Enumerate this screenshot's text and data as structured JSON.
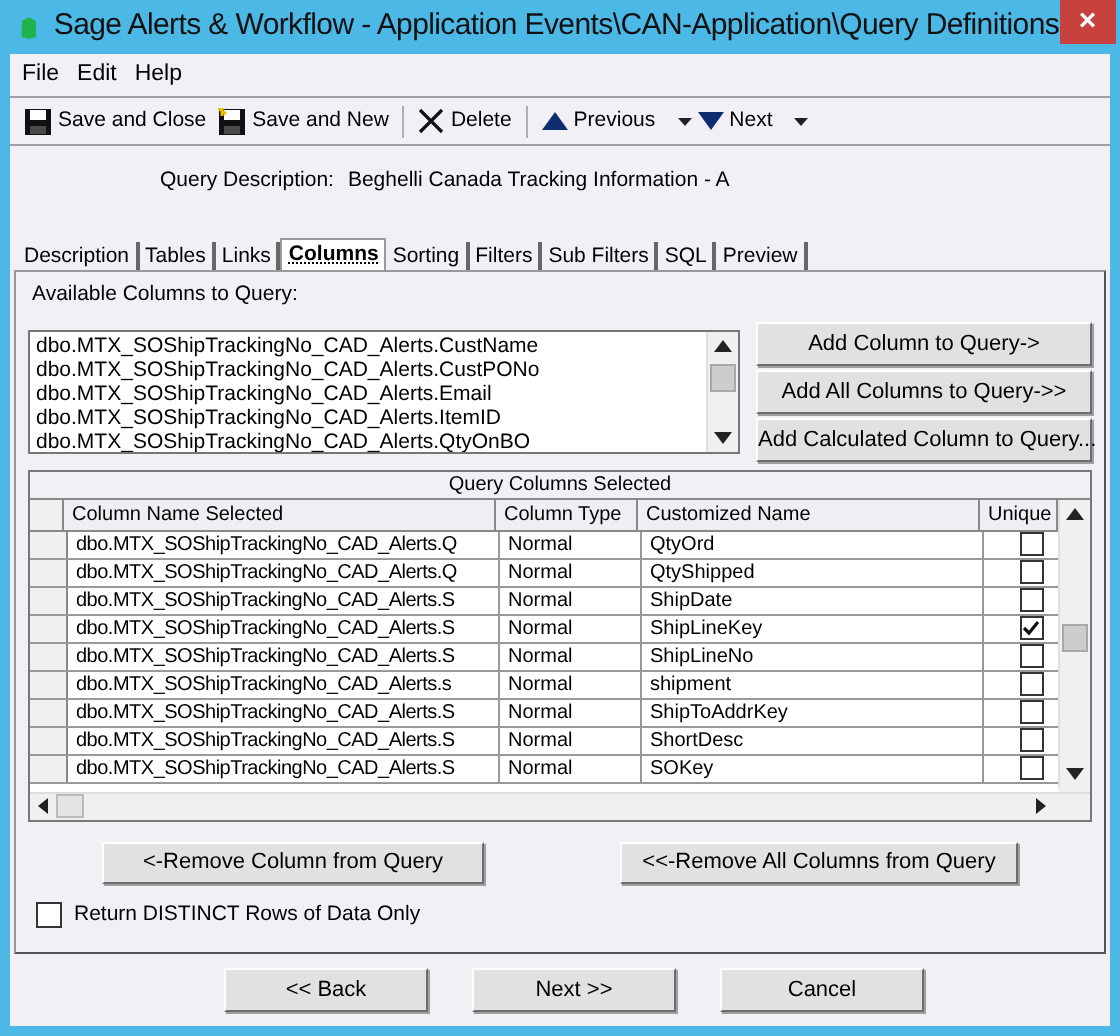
{
  "window": {
    "title": "Sage Alerts & Workflow - Application Events\\CAN-Application\\Query Definitions",
    "close": "×"
  },
  "menu": [
    "File",
    "Edit",
    "Help"
  ],
  "toolbar": [
    {
      "kind": "save",
      "label": "Save and Close"
    },
    {
      "kind": "savenew",
      "label": "Save and New"
    },
    {
      "kind": "delete",
      "label": "Delete"
    },
    {
      "kind": "previous",
      "label": "Previous"
    },
    {
      "kind": "next",
      "label": "Next"
    }
  ],
  "query_description": {
    "label": "Query Description:",
    "value": "Beghelli Canada Tracking Information - A"
  },
  "tabs": [
    {
      "label": "Description",
      "selected": false
    },
    {
      "label": "Tables",
      "selected": false
    },
    {
      "label": "Links",
      "selected": false
    },
    {
      "label": "Columns",
      "selected": true
    },
    {
      "label": "Sorting",
      "selected": false
    },
    {
      "label": "Filters",
      "selected": false
    },
    {
      "label": "Sub Filters",
      "selected": false
    },
    {
      "label": "SQL",
      "selected": false
    },
    {
      "label": "Preview",
      "selected": false
    }
  ],
  "available": {
    "label": "Available Columns to Query:",
    "items": [
      "dbo.MTX_SOShipTrackingNo_CAD_Alerts.CustName",
      "dbo.MTX_SOShipTrackingNo_CAD_Alerts.CustPONo",
      "dbo.MTX_SOShipTrackingNo_CAD_Alerts.Email",
      "dbo.MTX_SOShipTrackingNo_CAD_Alerts.ItemID",
      "dbo.MTX_SOShipTrackingNo_CAD_Alerts.QtyOnBO"
    ]
  },
  "add_buttons": [
    "Add Column to Query->",
    "Add All Columns to Query->>",
    "Add Calculated Column to Query..."
  ],
  "table": {
    "title": "Query Columns Selected",
    "columns": [
      "Column Name Selected",
      "Column Type",
      "Customized Name",
      "Unique"
    ],
    "rows": [
      {
        "name": "dbo.MTX_SOShipTrackingNo_CAD_Alerts.Q",
        "type": "Normal",
        "custom": "QtyOrd",
        "unique": false
      },
      {
        "name": "dbo.MTX_SOShipTrackingNo_CAD_Alerts.Q",
        "type": "Normal",
        "custom": "QtyShipped",
        "unique": false
      },
      {
        "name": "dbo.MTX_SOShipTrackingNo_CAD_Alerts.S",
        "type": "Normal",
        "custom": "ShipDate",
        "unique": false
      },
      {
        "name": "dbo.MTX_SOShipTrackingNo_CAD_Alerts.S",
        "type": "Normal",
        "custom": "ShipLineKey",
        "unique": true
      },
      {
        "name": "dbo.MTX_SOShipTrackingNo_CAD_Alerts.S",
        "type": "Normal",
        "custom": "ShipLineNo",
        "unique": false
      },
      {
        "name": "dbo.MTX_SOShipTrackingNo_CAD_Alerts.s",
        "type": "Normal",
        "custom": "shipment",
        "unique": false
      },
      {
        "name": "dbo.MTX_SOShipTrackingNo_CAD_Alerts.S",
        "type": "Normal",
        "custom": "ShipToAddrKey",
        "unique": false
      },
      {
        "name": "dbo.MTX_SOShipTrackingNo_CAD_Alerts.S",
        "type": "Normal",
        "custom": "ShortDesc",
        "unique": false
      },
      {
        "name": "dbo.MTX_SOShipTrackingNo_CAD_Alerts.S",
        "type": "Normal",
        "custom": "SOKey",
        "unique": false
      }
    ]
  },
  "remove_buttons": [
    "<-Remove Column from Query",
    "<<-Remove All Columns from Query"
  ],
  "distinct": {
    "label": "Return DISTINCT Rows of Data Only",
    "checked": false
  },
  "footer_buttons": [
    "<< Back",
    "Next >>",
    "Cancel"
  ]
}
